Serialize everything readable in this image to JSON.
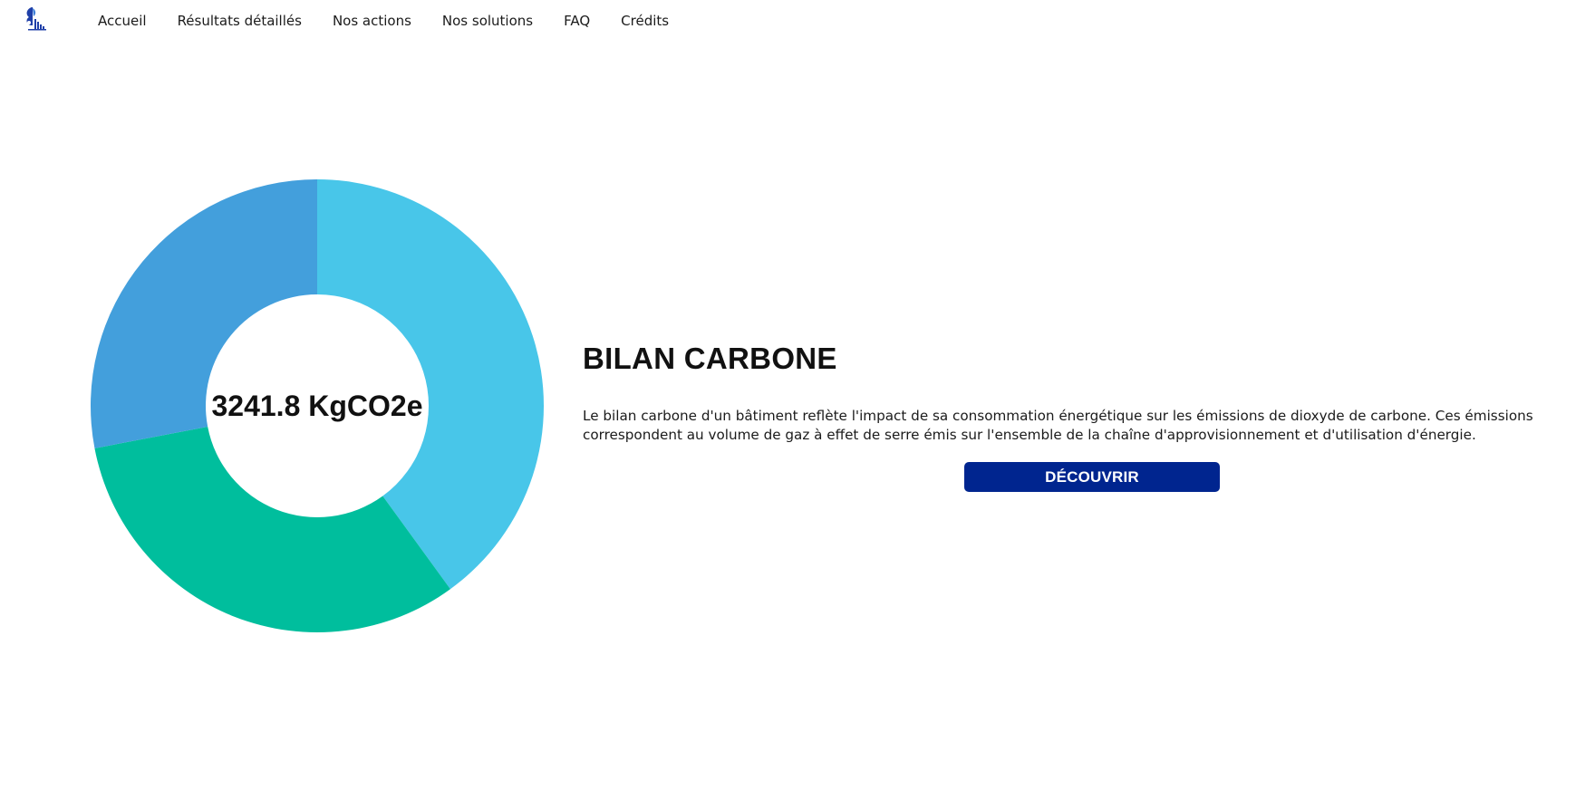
{
  "nav": {
    "logo_icon": "building-leaf-logo-icon",
    "items": [
      {
        "label": "Accueil"
      },
      {
        "label": "Résultats détaillés"
      },
      {
        "label": "Nos actions"
      },
      {
        "label": "Nos solutions"
      },
      {
        "label": "FAQ"
      },
      {
        "label": "Crédits"
      }
    ]
  },
  "chart_data": {
    "type": "pie",
    "variant": "donut",
    "center_label": "3241.8 KgCO2e",
    "slices": [
      {
        "fraction": 0.4,
        "color": "#48c6e9"
      },
      {
        "fraction": 0.32,
        "color": "#00be9d"
      },
      {
        "fraction": 0.28,
        "color": "#439fdc"
      }
    ],
    "legend": "none"
  },
  "info": {
    "title": "BILAN CARBONE",
    "description": "Le bilan carbone d'un bâtiment reflète l'impact de sa consommation énergétique sur les émissions de dioxyde de carbone. Ces émissions correspondent au volume de gaz à effet de serre émis sur l'ensemble de la chaîne d'approvisionnement et d'utilisation d'énergie.",
    "button_label": "DÉCOUVRIR",
    "button_color": "#00258f"
  }
}
